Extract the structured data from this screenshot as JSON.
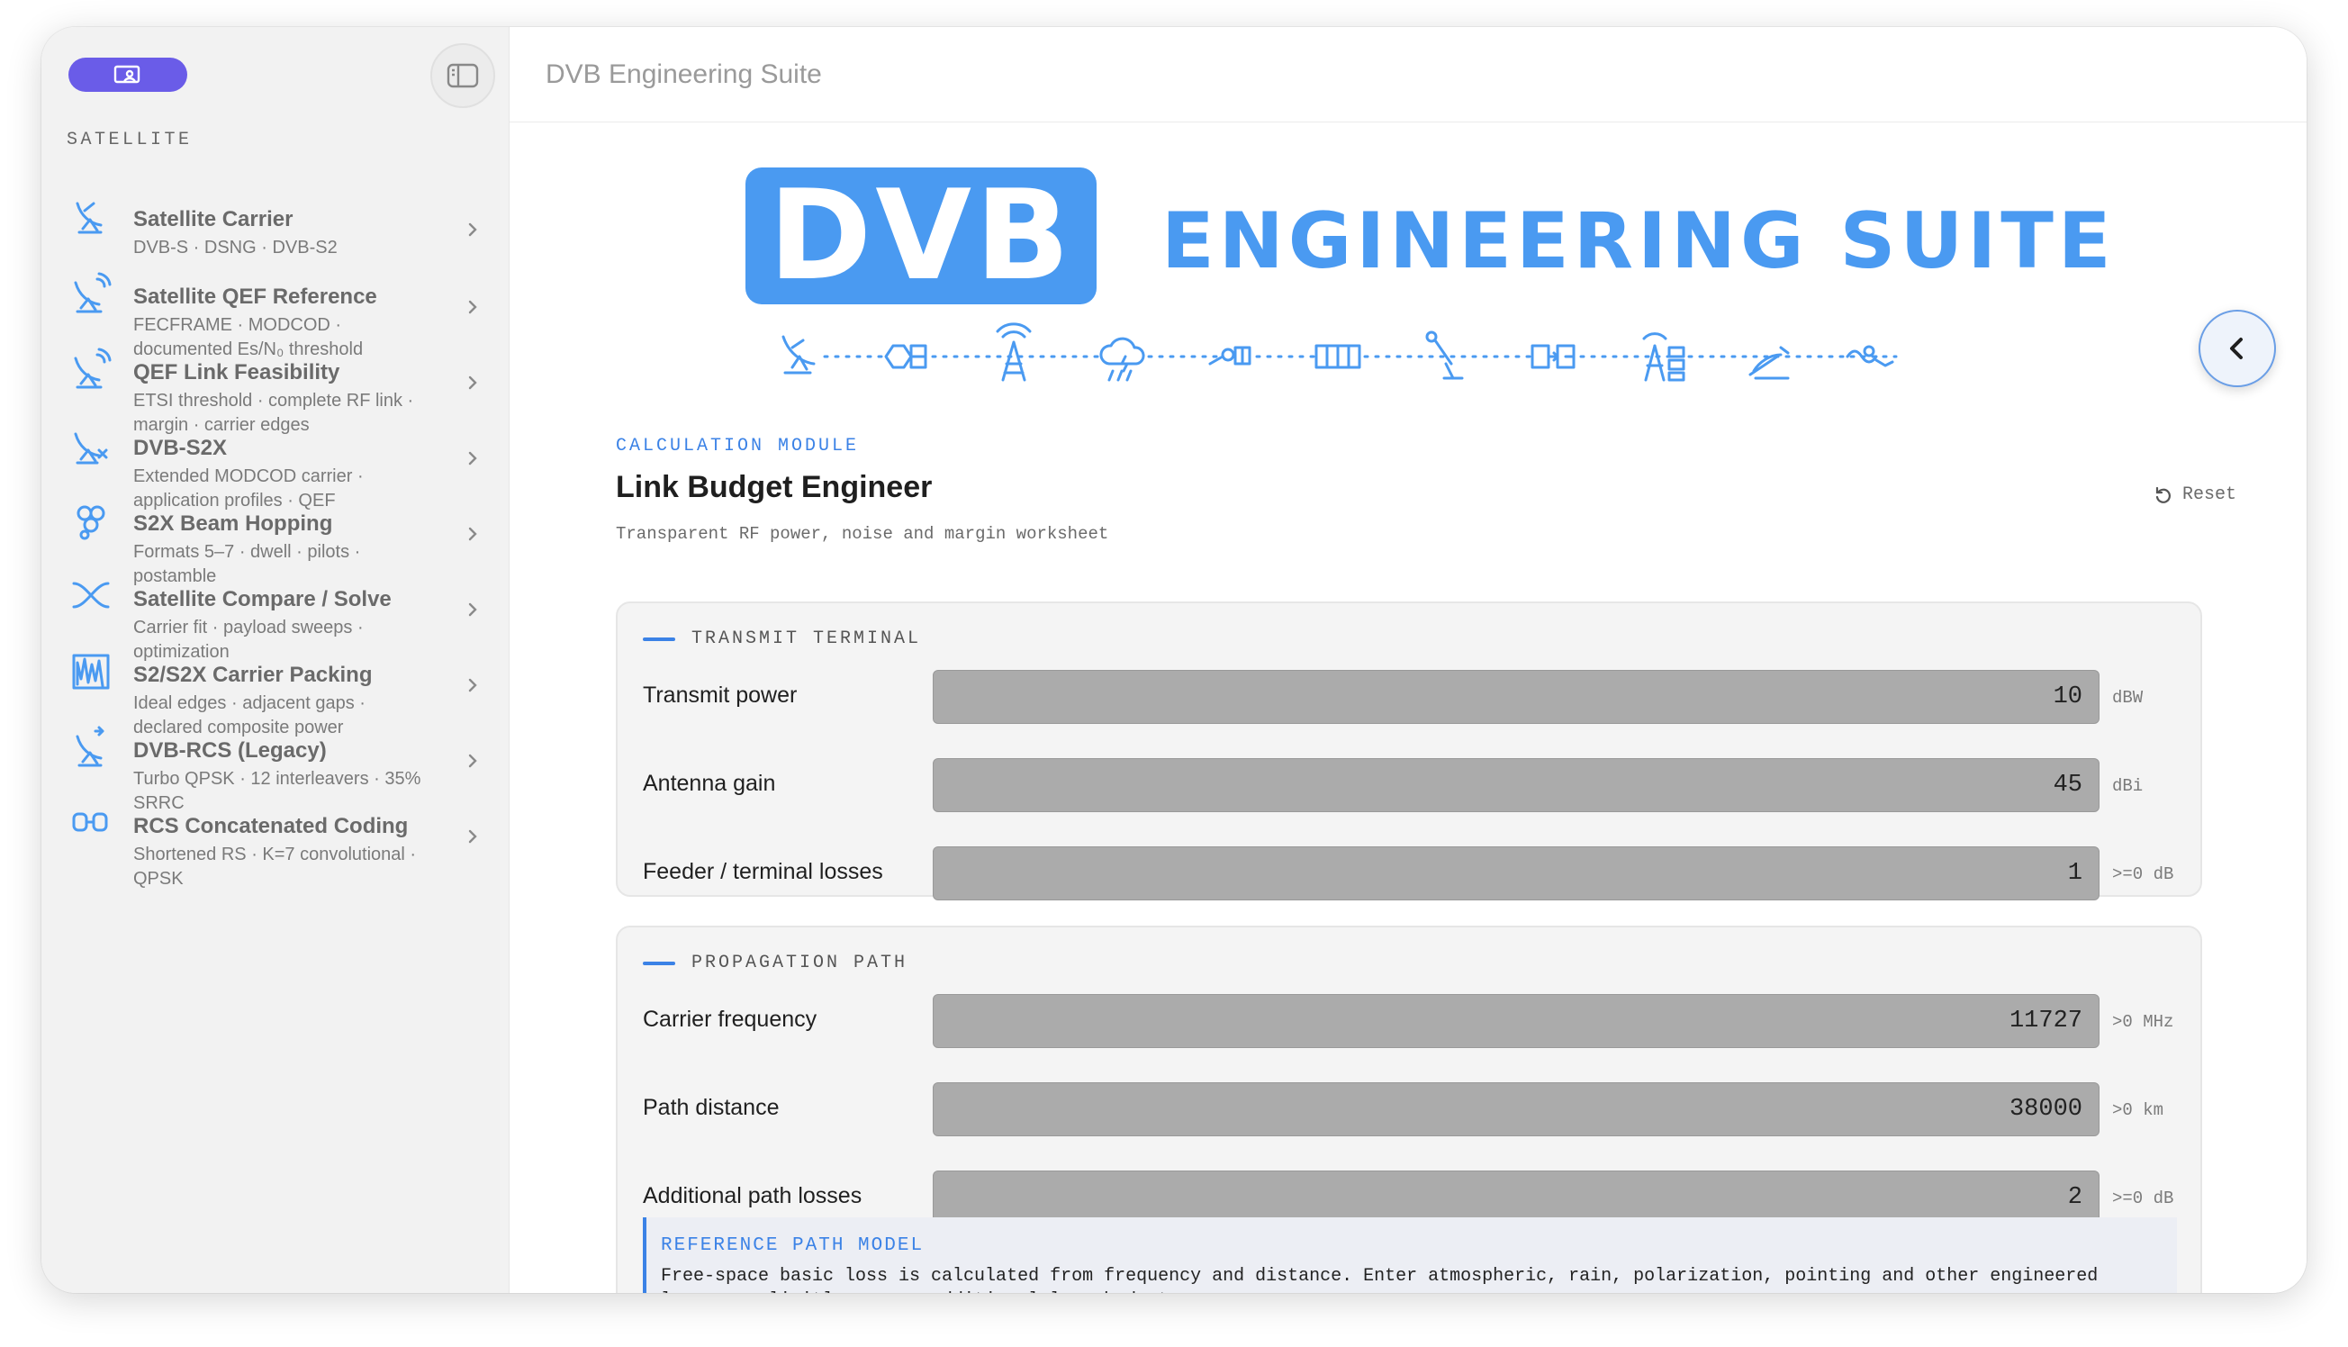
{
  "app": {
    "title": "DVB Engineering Suite"
  },
  "sidebar": {
    "section_label": "SATELLITE",
    "items": [
      {
        "title": "Satellite Carrier",
        "sub": "DVB-S · DSNG · DVB-S2",
        "icon": "satellite-dish-icon"
      },
      {
        "title": "Satellite QEF Reference",
        "sub": "FECFRAME · MODCOD · documented Es/N₀ threshold",
        "icon": "satellite-dish-signal-icon"
      },
      {
        "title": "QEF Link Feasibility",
        "sub": "ETSI threshold · complete RF link · margin · carrier edges",
        "icon": "satellite-dish-signal-icon"
      },
      {
        "title": "DVB-S2X",
        "sub": "Extended MODCOD carrier · application profiles · QEF",
        "icon": "satellite-dish-x-icon"
      },
      {
        "title": "S2X Beam Hopping",
        "sub": "Formats 5–7 · dwell · pilots · postamble",
        "icon": "beam-hopping-icon"
      },
      {
        "title": "Satellite Compare / Solve",
        "sub": "Carrier fit · payload sweeps · optimization",
        "icon": "compare-icon"
      },
      {
        "title": "S2/S2X Carrier Packing",
        "sub": "Ideal edges · adjacent gaps · declared composite power",
        "icon": "spectrum-icon"
      },
      {
        "title": "DVB-RCS (Legacy)",
        "sub": "Turbo QPSK · 12 interleavers · 35% SRRC",
        "icon": "satellite-dish-return-icon"
      },
      {
        "title": "RCS Concatenated Coding",
        "sub": "Shortened RS · K=7 convolutional · QPSK",
        "icon": "concatenated-coding-icon"
      }
    ]
  },
  "logo": {
    "box_text": "DVB",
    "wordmark": "ENGINEERING SUITE"
  },
  "module": {
    "label": "CALCULATION MODULE",
    "title": "Link Budget Engineer",
    "subtitle": "Transparent RF power, noise and margin worksheet",
    "reset_label": "Reset"
  },
  "transmit": {
    "heading": "TRANSMIT TERMINAL",
    "rows": [
      {
        "label": "Transmit power",
        "value": "10",
        "unit": "dBW"
      },
      {
        "label": "Antenna gain",
        "value": "45",
        "unit": "dBi"
      },
      {
        "label": "Feeder / terminal losses",
        "value": "1",
        "unit": ">=0 dB"
      }
    ]
  },
  "propagation": {
    "heading": "PROPAGATION PATH",
    "rows": [
      {
        "label": "Carrier frequency",
        "value": "11727",
        "unit": ">0 MHz"
      },
      {
        "label": "Path distance",
        "value": "38000",
        "unit": ">0 km"
      },
      {
        "label": "Additional path losses",
        "value": "2",
        "unit": ">=0 dB"
      }
    ],
    "reference": {
      "title": "REFERENCE PATH MODEL",
      "text": "Free-space basic loss is calculated from frequency and distance. Enter atmospheric, rain, polarization, pointing and other engineered losses explicitly as one additional loss budget."
    }
  },
  "colors": {
    "accent": "#4a9af1",
    "link": "#3b82e6",
    "pill": "#6a5ce8",
    "field": "#ababab"
  }
}
